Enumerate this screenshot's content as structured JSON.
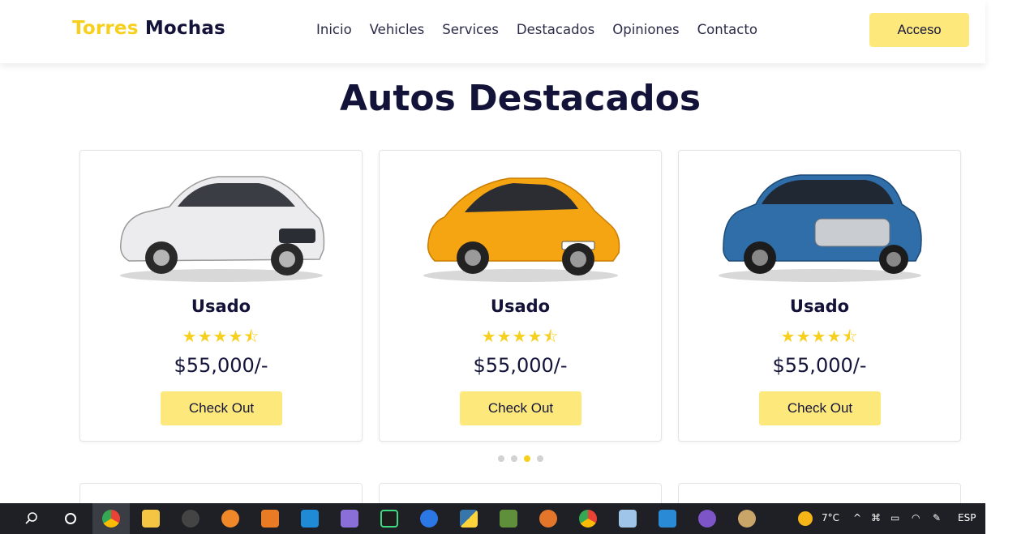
{
  "header": {
    "logo_part1": "Torres",
    "logo_part2": "Mochas",
    "nav": [
      "Inicio",
      "Vehicles",
      "Services",
      "Destacados",
      "Opiniones",
      "Contacto"
    ],
    "login_label": "Acceso"
  },
  "section": {
    "title_highlight": "Autos",
    "title_rest": "Destacados"
  },
  "cars": [
    {
      "title": "Usado",
      "stars": "★★★★⯪",
      "price": "$55,000/-",
      "button": "Check Out",
      "color": "#e8e8ea"
    },
    {
      "title": "Usado",
      "stars": "★★★★⯪",
      "price": "$55,000/-",
      "button": "Check Out",
      "color": "#f5a511"
    },
    {
      "title": "Usado",
      "stars": "★★★★⯪",
      "price": "$55,000/-",
      "button": "Check Out",
      "color": "#2f6ea8"
    }
  ],
  "slider": {
    "dot_count": 4,
    "active_index": 2
  },
  "taskbar": {
    "temperature": "7°C",
    "language": "ESP",
    "apps": [
      "search-icon",
      "cortana-icon",
      "chrome-icon",
      "file-explorer-icon",
      "inkscape-icon",
      "blender-icon",
      "sublime-text-icon",
      "vscode-icon",
      "app-icon",
      "pycharm-icon",
      "app-icon",
      "python-icon",
      "app-icon",
      "app-icon",
      "chrome-icon",
      "app-icon",
      "photos-icon",
      "app-icon",
      "paint-icon"
    ]
  },
  "colors": {
    "accent": "#fde97b",
    "brand_yellow": "#f7cf1d",
    "dark_navy": "#13133a"
  }
}
